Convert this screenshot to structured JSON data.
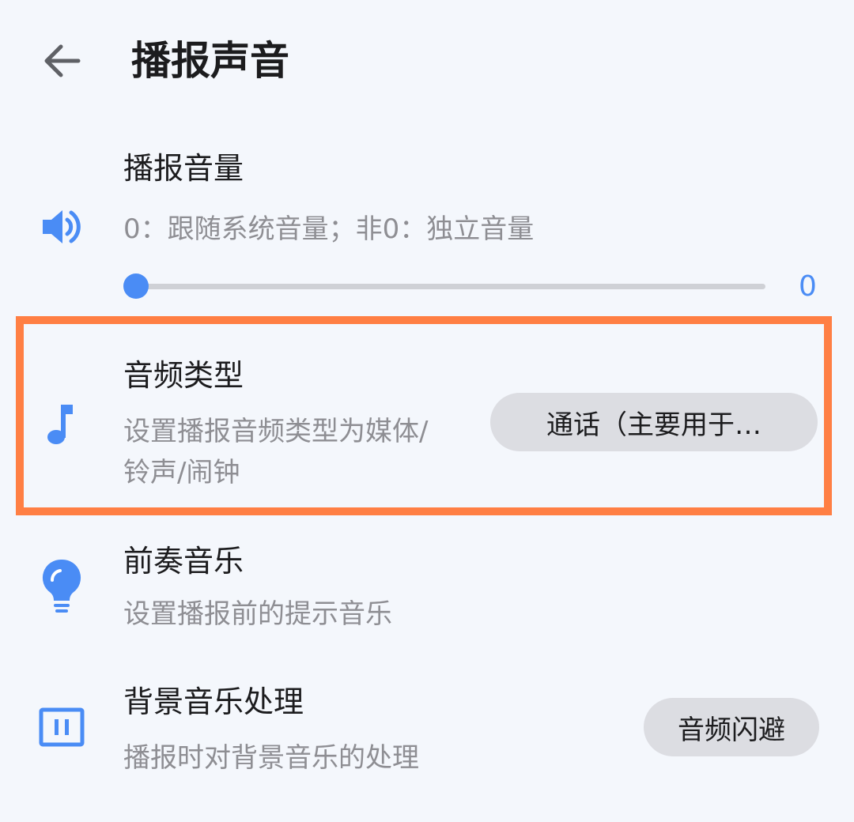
{
  "header": {
    "title": "播报声音"
  },
  "volume": {
    "title": "播报音量",
    "description": "0：跟随系统音量；非0：独立音量",
    "value": 0,
    "value_label": "0",
    "icon": "speaker-volume-icon"
  },
  "audio_type": {
    "title": "音频类型",
    "description": "设置播报音频类型为媒体/铃声/闹钟",
    "selected": "通话（主要用于…",
    "icon": "music-note-icon"
  },
  "prelude_music": {
    "title": "前奏音乐",
    "description": "设置播报前的提示音乐",
    "icon": "lightbulb-icon"
  },
  "background_music": {
    "title": "背景音乐处理",
    "description": "播报时对背景音乐的处理",
    "selected": "音频闪避",
    "icon": "pause-box-icon"
  },
  "colors": {
    "accent": "#4a8cf5",
    "highlight": "#ff7f44",
    "background": "#f4f7fc"
  }
}
